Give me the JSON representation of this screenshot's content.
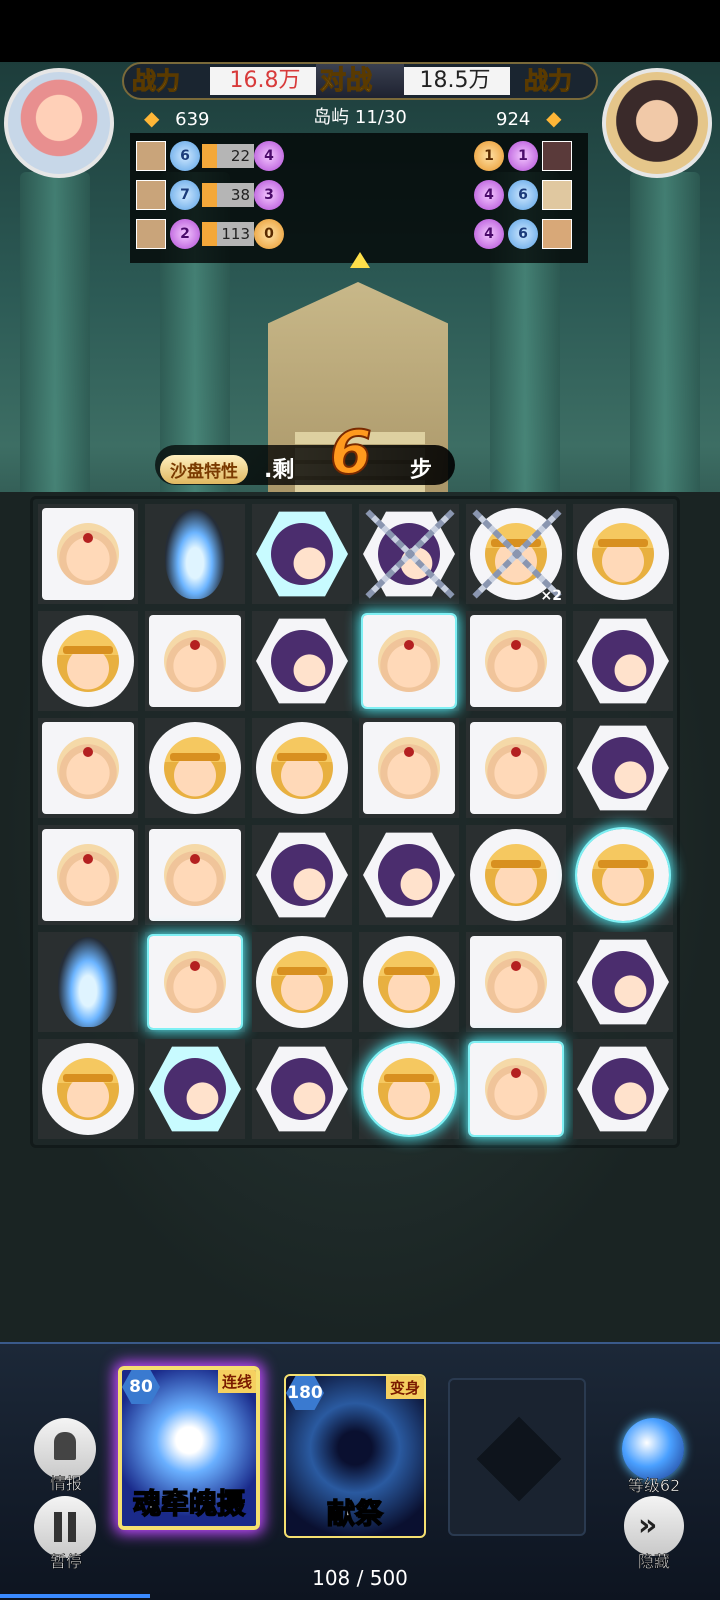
{
  "header": {
    "left_power_label": "战力",
    "left_power_value": "16.8万",
    "vs_label": "对战",
    "right_power_value": "18.5万",
    "right_power_label": "战力",
    "left_resource": "639",
    "stage_label": "岛屿 11/30",
    "right_resource": "924"
  },
  "left_team": [
    {
      "blue": "6",
      "bar": "22",
      "purple": "4"
    },
    {
      "blue": "7",
      "bar": "38",
      "purple": "3"
    },
    {
      "blue": "2",
      "bar": "113",
      "purple": "0"
    }
  ],
  "right_team": [
    {
      "a": "1",
      "b": "1"
    },
    {
      "a": "4",
      "b": "6"
    },
    {
      "a": "4",
      "b": "6"
    }
  ],
  "steps": {
    "trait_label": "沙盘特性",
    "prefix": "剩",
    "count": "6",
    "suffix": "步"
  },
  "board": {
    "rows": [
      [
        "monk-square",
        "fire",
        "ninja-hex-glow",
        "chain-ninja",
        "chain2-king",
        "king-circle"
      ],
      [
        "king-circle",
        "monk-square",
        "ninja-hex",
        "monk-square-glow",
        "monk-square",
        "ninja-hex"
      ],
      [
        "monk-square",
        "king-circle",
        "king-circle",
        "monk-square",
        "monk-square",
        "ninja-hex"
      ],
      [
        "monk-square",
        "monk-square",
        "ninja-hex",
        "ninja-hex",
        "king-circle",
        "king-circle-glow"
      ],
      [
        "fire",
        "monk-square-glow",
        "king-circle",
        "king-circle",
        "monk-square",
        "ninja-hex"
      ],
      [
        "king-circle",
        "ninja-hex-glow",
        "ninja-hex",
        "king-circle-glow",
        "monk-square-glow",
        "ninja-hex"
      ]
    ],
    "chain_count": "×2"
  },
  "controls": {
    "intel_label": "情报",
    "pause_label": "暂停",
    "hide_label": "隐藏",
    "level_label": "等级62"
  },
  "cards": [
    {
      "cost": "80",
      "tag": "连线",
      "name": "魂牵魄摄"
    },
    {
      "cost": "180",
      "tag": "变身",
      "name": "献祭"
    }
  ],
  "energy": "108 / 500",
  "colors": {
    "glow": "#4ce0e8",
    "steps_number": "#ff9a1e",
    "power_left": "#d83a3a"
  }
}
